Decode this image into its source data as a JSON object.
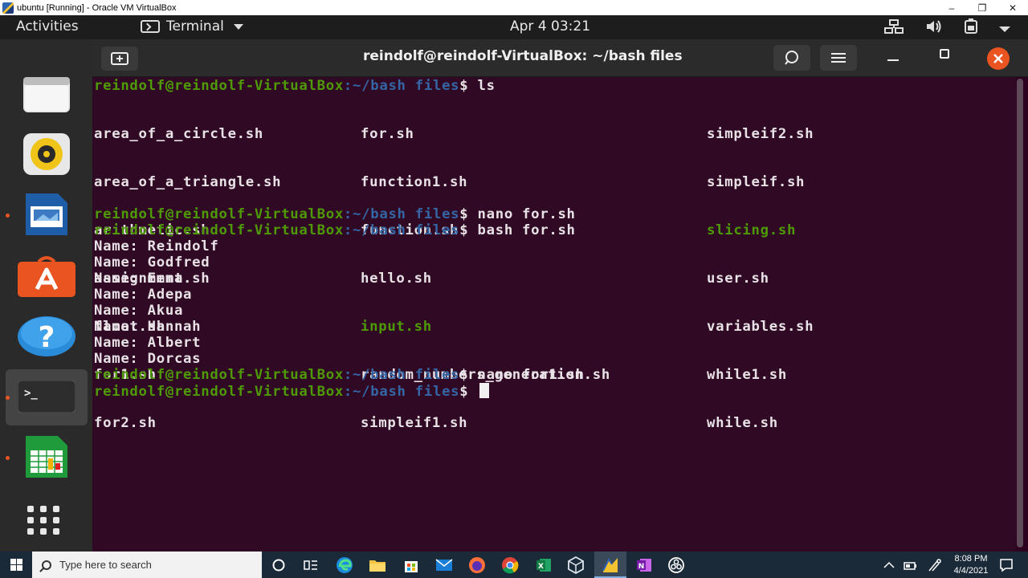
{
  "vbox": {
    "title": "ubuntu [Running] - Oracle VM VirtualBox",
    "controls": [
      "–",
      "❐",
      "✕"
    ]
  },
  "topbar": {
    "activities": "Activities",
    "app_name": "Terminal",
    "clock": "Apr 4  03:21",
    "icons": [
      "network-icon",
      "volume-icon",
      "battery-icon",
      "power-menu-icon"
    ]
  },
  "dock": {
    "items": [
      "files",
      "rhythmbox",
      "libreoffice-impress",
      "ubuntu-software",
      "help",
      "terminal",
      "libreoffice-calc",
      "show-applications"
    ],
    "running": [
      "libreoffice-impress",
      "terminal",
      "libreoffice-calc"
    ]
  },
  "terminal": {
    "title": "reindolf@reindolf-VirtualBox: ~/bash files",
    "prompt_user": "reindolf@reindolf-VirtualBox",
    "prompt_path": ":~/bash files",
    "prompt_symbol": "$ ",
    "ls_cmd": "ls",
    "ls_col1": [
      "area_of_a_circle.sh",
      "area_of_a_triangle.sh",
      "arithmetic.sh",
      "assignment.sh",
      "float.sh",
      "for1.sh",
      "for2.sh"
    ],
    "ls_col2": [
      "for.sh",
      "function1.sh",
      "function.sh",
      "hello.sh",
      "input.sh",
      "random_numbers_generation.sh",
      "simpleif1.sh"
    ],
    "ls_col3": [
      "simpleif2.sh",
      "simpleif.sh",
      "slicing.sh",
      "user.sh",
      "variables.sh",
      "while1.sh",
      "while.sh"
    ],
    "cmd2": "nano for.sh",
    "cmd3": "bash for.sh",
    "output": [
      "Name: Reindolf",
      "Name: Godfred",
      "Name: Emma",
      "Name: Adepa",
      "Name: Akua",
      "Name: Hannah",
      "Name: Albert",
      "Name: Dorcas"
    ],
    "cmd4": "nano for1.sh",
    "cmd5": ""
  },
  "colors": {
    "terminal_bg": "#300a24",
    "prompt_user": "#4e9a06",
    "prompt_path": "#3465a4",
    "executable": "#4e9a06",
    "close_button": "#e95420"
  },
  "taskbar": {
    "search_placeholder": "Type here to search",
    "time": "8:08 PM",
    "date": "4/4/2021",
    "apps": [
      "cortana",
      "task-view",
      "edge",
      "file-explorer",
      "store",
      "mail",
      "firefox",
      "chrome",
      "excel",
      "virtualbox",
      "virtualbox-vm",
      "onenote",
      "obs"
    ]
  }
}
